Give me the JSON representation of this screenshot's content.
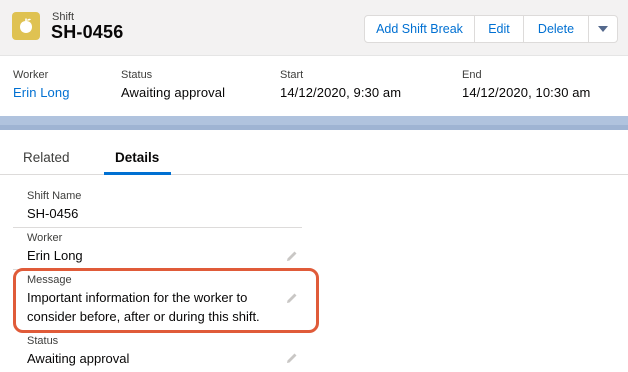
{
  "header": {
    "object_type": "Shift",
    "title": "SH-0456",
    "icon": "shift-icon",
    "icon_color": "#dfc252",
    "actions": [
      "Add Shift Break",
      "Edit",
      "Delete"
    ],
    "more_icon": "chevron-down-icon"
  },
  "highlights": [
    {
      "label": "Worker",
      "value": "Erin Long"
    },
    {
      "label": "Status",
      "value": "Awaiting approval"
    },
    {
      "label": "Start",
      "value": "14/12/2020, 9:30 am"
    },
    {
      "label": "End",
      "value": "14/12/2020, 10:30 am"
    }
  ],
  "tabs": [
    {
      "label": "Related",
      "active": false
    },
    {
      "label": "Details",
      "active": true
    }
  ],
  "details": {
    "shift_name": {
      "label": "Shift Name",
      "value": "SH-0456"
    },
    "worker": {
      "label": "Worker",
      "value": "Erin Long"
    },
    "message": {
      "label": "Message",
      "lines": [
        "Important information for the worker to",
        "consider before, after or during this shift."
      ]
    },
    "status": {
      "label": "Status",
      "value": "Awaiting approval"
    }
  },
  "colors": {
    "link": "#0070d2",
    "callout": "#e05b39",
    "header_bg": "#f3f2f2"
  }
}
